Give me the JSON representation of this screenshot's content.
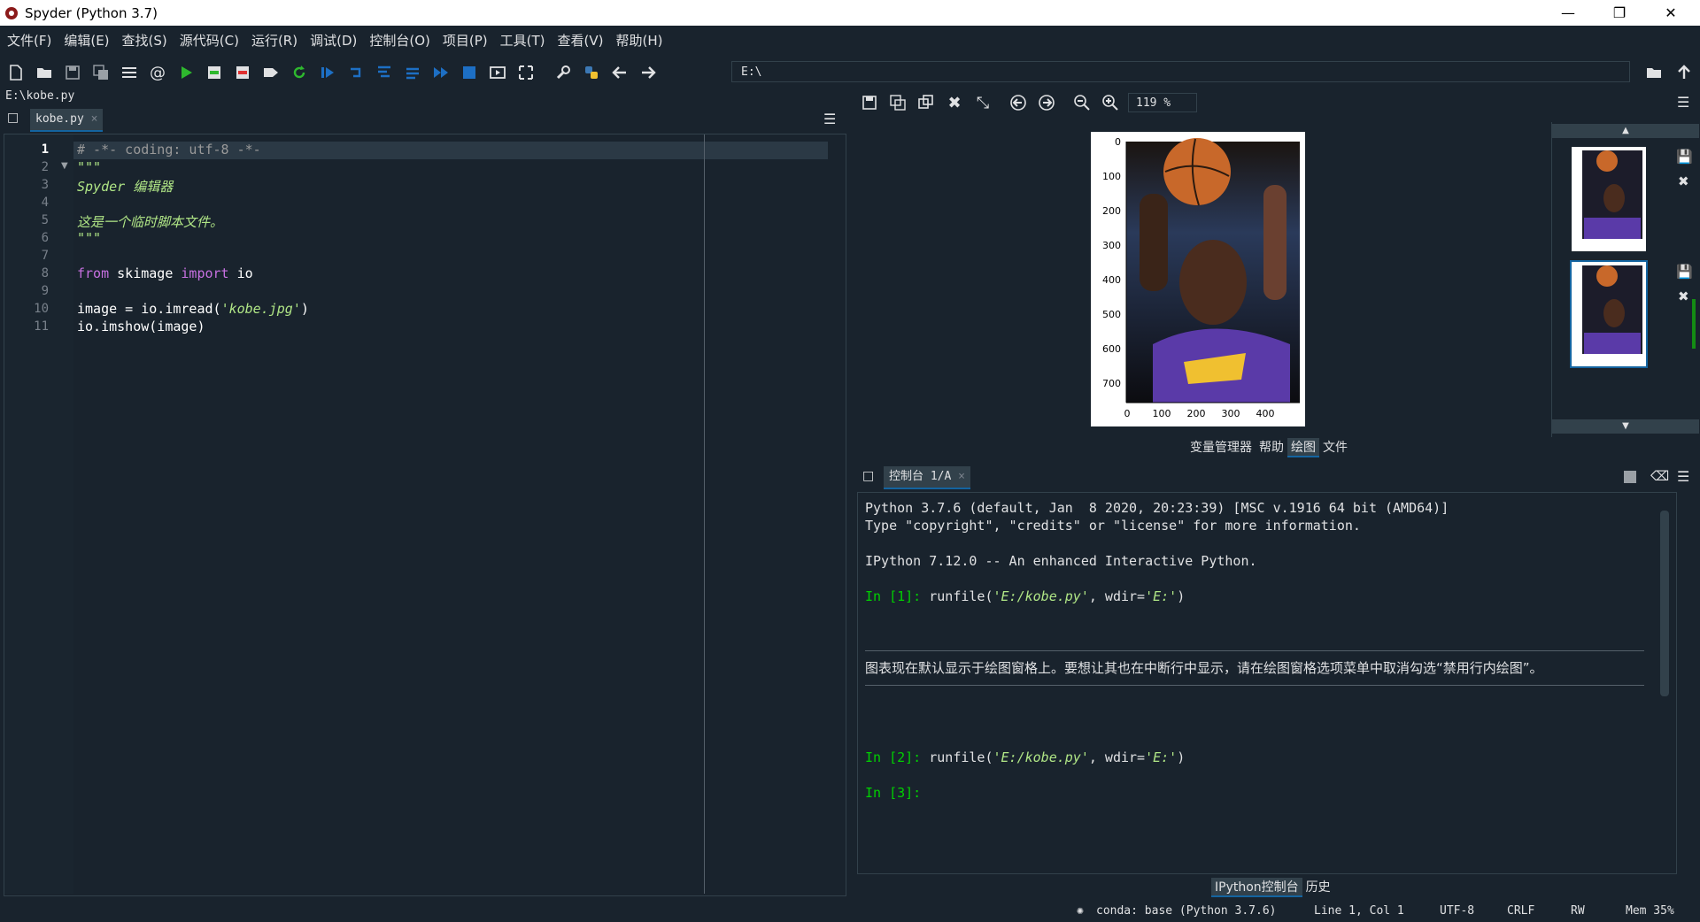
{
  "window": {
    "title": "Spyder (Python 3.7)"
  },
  "menu": [
    "文件(F)",
    "编辑(E)",
    "查找(S)",
    "源代码(C)",
    "运行(R)",
    "调试(D)",
    "控制台(O)",
    "项目(P)",
    "工具(T)",
    "查看(V)",
    "帮助(H)"
  ],
  "toolbar": {
    "path": "E:\\"
  },
  "editor": {
    "file_path": "E:\\kobe.py",
    "tab_label": "kobe.py",
    "line_numbers": [
      "1",
      "2",
      "3",
      "4",
      "5",
      "6",
      "7",
      "8",
      "9",
      "10",
      "11"
    ],
    "lines": {
      "l1": "# -*- coding: utf-8 -*-",
      "l2": "\"\"\"",
      "l3": "Spyder 编辑器",
      "l5": "这是一个临时脚本文件。",
      "l6": "\"\"\"",
      "l8_kw1": "from",
      "l8_mid": " skimage ",
      "l8_kw2": "import",
      "l8_end": " io",
      "l10_a": "image = io.imread(",
      "l10_str": "'kobe.jpg'",
      "l10_b": ")",
      "l11": "io.imshow(image)"
    }
  },
  "plots": {
    "zoom": "119 %",
    "y_ticks": [
      "0",
      "100",
      "200",
      "300",
      "400",
      "500",
      "600",
      "700"
    ],
    "x_ticks": [
      "0",
      "100",
      "200",
      "300",
      "400"
    ]
  },
  "right_tabs": [
    "变量管理器",
    "帮助",
    "绘图",
    "文件"
  ],
  "console": {
    "tab_label": "控制台 1/A",
    "line1": "Python 3.7.6 (default, Jan  8 2020, 20:23:39) [MSC v.1916 64 bit (AMD64)]",
    "line2": "Type \"copyright\", \"credits\" or \"license\" for more information.",
    "line3": "IPython 7.12.0 -- An enhanced Interactive Python.",
    "in1_prompt": "In [1]:",
    "in1_code_a": " runfile(",
    "in1_str1": "'E:/kobe.py'",
    "in1_code_b": ", wdir=",
    "in1_str2": "'E:'",
    "in1_code_c": ")",
    "info": "图表现在默认显示于绘图窗格上。要想让其也在中断行中显示，请在绘图窗格选项菜单中取消勾选“禁用行内绘图”。",
    "in2_prompt": "In [2]:",
    "in2_code_a": " runfile(",
    "in2_str1": "'E:/kobe.py'",
    "in2_code_b": ", wdir=",
    "in2_str2": "'E:'",
    "in2_code_c": ")",
    "in3_prompt": "In [3]:"
  },
  "bottom_tabs": [
    "IPython控制台",
    "历史"
  ],
  "status": {
    "conda": "conda: base (Python 3.7.6)",
    "position": "Line 1, Col 1",
    "encoding": "UTF-8",
    "eol": "CRLF",
    "rw": "RW",
    "mem": "Mem 35%"
  },
  "colors": {
    "background": "#19232d",
    "accent": "#1464a0",
    "prompt": "#00d000"
  }
}
